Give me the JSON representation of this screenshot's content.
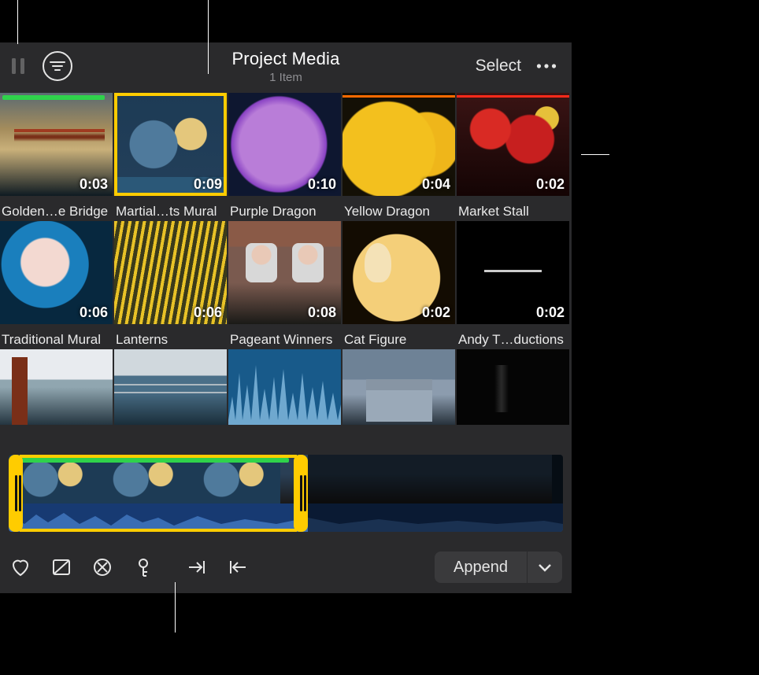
{
  "header": {
    "title": "Project Media",
    "subtitle": "1 Item",
    "select_label": "Select"
  },
  "clips": [
    {
      "name": "Golden…e Bridge",
      "duration": "0:03",
      "scene": "scene-bridge",
      "green_width": 130,
      "selected": false
    },
    {
      "name": "Martial…ts Mural",
      "duration": "0:09",
      "scene": "scene-mural",
      "green_width": 0,
      "selected": true
    },
    {
      "name": "Purple Dragon",
      "duration": "0:10",
      "scene": "scene-purple",
      "green_width": 0,
      "selected": false
    },
    {
      "name": "Yellow Dragon",
      "duration": "0:04",
      "scene": "scene-yellow",
      "orange": true,
      "selected": false
    },
    {
      "name": "Market Stall",
      "duration": "0:02",
      "scene": "scene-market",
      "red": true,
      "selected": false
    },
    {
      "name": "Traditional Mural",
      "duration": "0:06",
      "scene": "scene-trad",
      "selected": false
    },
    {
      "name": "Lanterns",
      "duration": "0:06",
      "scene": "scene-lanterns",
      "selected": false
    },
    {
      "name": "Pageant Winners",
      "duration": "0:08",
      "scene": "scene-pageant",
      "selected": false
    },
    {
      "name": "Cat Figure",
      "duration": "0:02",
      "scene": "scene-cat",
      "selected": false
    },
    {
      "name": "Andy T…ductions",
      "duration": "0:02",
      "scene": "scene-titlecard",
      "selected": false
    }
  ],
  "partial_row": [
    {
      "scene": "scene-gg2"
    },
    {
      "scene": "scene-bay"
    },
    {
      "scene": "audio-wave"
    },
    {
      "scene": "scene-hall"
    },
    {
      "scene": "scene-dark"
    }
  ],
  "toolbar": {
    "append_label": "Append"
  }
}
